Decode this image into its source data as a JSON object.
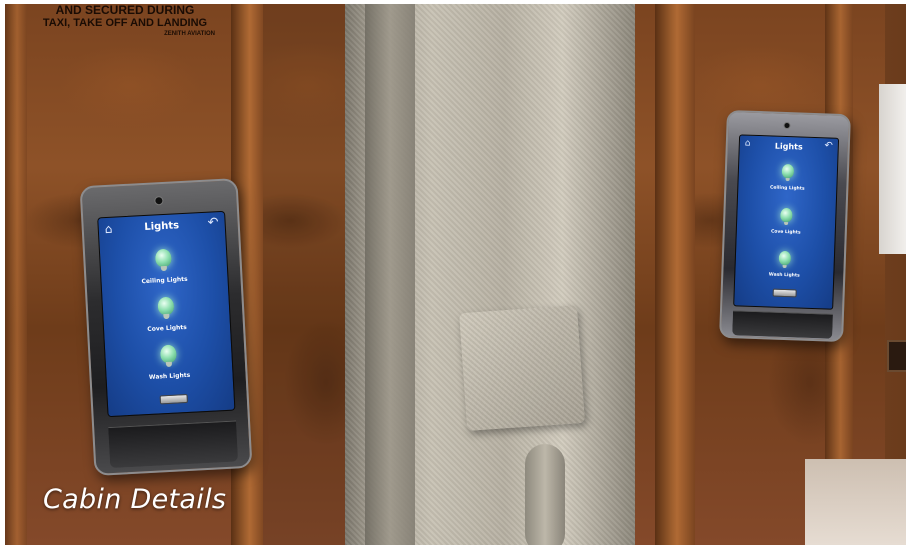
{
  "caption": "Cabin Details",
  "warning_sign": {
    "line1": "AND SECURED DURING",
    "line2": "TAXI, TAKE OFF AND LANDING",
    "line3": "ZENITH AVIATION"
  },
  "left_panel": {
    "title": "Lights",
    "icons": {
      "home": "home-icon",
      "back": "back-arrow-icon",
      "light": "light-bulb-icon"
    },
    "items": [
      {
        "label": "Ceiling Lights"
      },
      {
        "label": "Cove Lights"
      },
      {
        "label": "Wash Lights"
      }
    ]
  },
  "right_panel": {
    "title": "Lights",
    "items": [
      {
        "label": "Ceiling Lights"
      },
      {
        "label": "Cove Lights"
      },
      {
        "label": "Wash Lights"
      }
    ]
  },
  "colors": {
    "screen_blue": "#1d4fa8",
    "wood": "#7b4420",
    "fabric": "#bfb9ab",
    "bulb_glow": "#8fe0b0",
    "caption": "#ffffff"
  }
}
